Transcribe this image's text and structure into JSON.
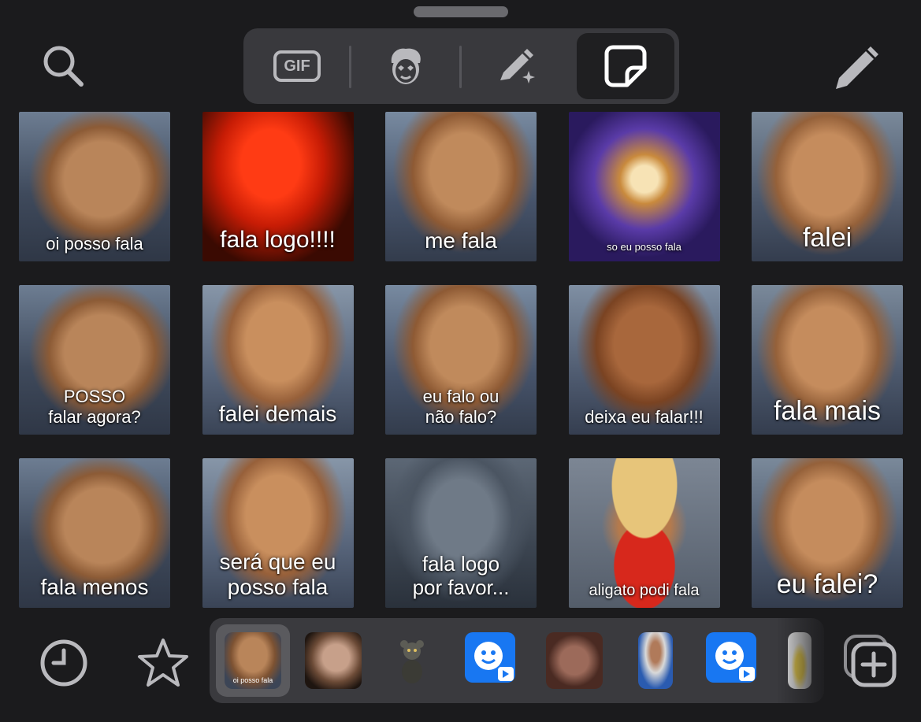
{
  "toolbar": {
    "left_icon": "search-icon",
    "right_icon": "pencil-icon",
    "tabs": [
      {
        "icon": "gif-icon",
        "label": "GIF",
        "active": false
      },
      {
        "icon": "avatar-face-icon",
        "active": false
      },
      {
        "icon": "magic-pen-icon",
        "active": false
      },
      {
        "icon": "sticker-icon",
        "active": true
      }
    ]
  },
  "stickers": [
    {
      "caption": "oi posso fala",
      "style": "dog1"
    },
    {
      "caption": "fala logo!!!!",
      "style": "red"
    },
    {
      "caption": "me fala",
      "style": "dog2"
    },
    {
      "caption": "so eu posso fala",
      "style": "cosmic"
    },
    {
      "caption": "falei",
      "style": "dog3"
    },
    {
      "caption": "POSSO\nfalar agora?",
      "style": "dog1"
    },
    {
      "caption": "falei demais",
      "style": "dog4"
    },
    {
      "caption": "eu falo ou\nnão falo?",
      "style": "dog2"
    },
    {
      "caption": "deixa eu falar!!!",
      "style": "dog5"
    },
    {
      "caption": "fala mais",
      "style": "dog3"
    },
    {
      "caption": "fala menos",
      "style": "dog1"
    },
    {
      "caption": "será que eu\nposso fala",
      "style": "dog4"
    },
    {
      "caption": "fala logo\npor favor...",
      "style": "grey"
    },
    {
      "caption": "aligato podi fala",
      "style": "hat"
    },
    {
      "caption": "eu falei?",
      "style": "dog3"
    }
  ],
  "bottom": {
    "recent_icon": "clock-icon",
    "favorites_icon": "star-icon",
    "add_icon": "add-sticker-icon",
    "packs": [
      {
        "name": "sticker-pack-dog",
        "caption": "oi posso fala"
      },
      {
        "name": "sticker-pack-woman"
      },
      {
        "name": "sticker-pack-rat"
      },
      {
        "name": "sticker-pack-app-1"
      },
      {
        "name": "sticker-pack-people"
      },
      {
        "name": "sticker-pack-man"
      },
      {
        "name": "sticker-pack-app-2"
      },
      {
        "name": "sticker-pack-partial"
      }
    ]
  },
  "colors": {
    "background": "#1b1b1d",
    "segment": "#39393d",
    "active_segment": "#1f1f21",
    "icon": "#b9b9bd",
    "app_blue": "#1877f2"
  }
}
